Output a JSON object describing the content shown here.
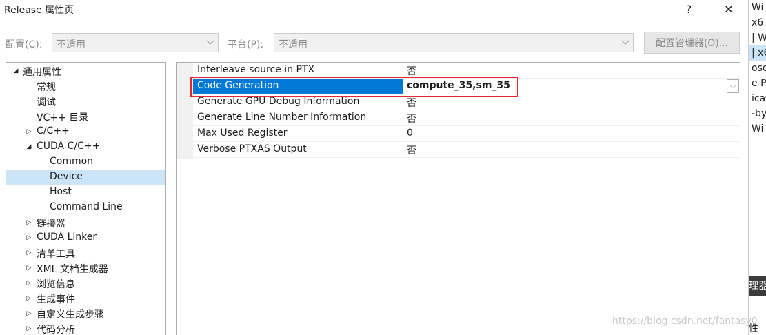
{
  "window": {
    "title": "Release 属性页",
    "help_glyph": "?",
    "close_glyph": "✕"
  },
  "config_bar": {
    "config_label": "配置(C):",
    "config_value": "不适用",
    "platform_label": "平台(P):",
    "platform_value": "不适用",
    "manager_button": "配置管理器(O)..."
  },
  "tree": {
    "items": [
      {
        "label": "通用属性",
        "toggle": "◢"
      },
      {
        "label": "常规",
        "toggle": ""
      },
      {
        "label": "调试",
        "toggle": ""
      },
      {
        "label": "VC++ 目录",
        "toggle": ""
      },
      {
        "label": "C/C++",
        "toggle": "▷"
      },
      {
        "label": "CUDA C/C++",
        "toggle": "◢"
      },
      {
        "label": "Common",
        "toggle": ""
      },
      {
        "label": "Device",
        "toggle": "",
        "selected": true
      },
      {
        "label": "Host",
        "toggle": ""
      },
      {
        "label": "Command Line",
        "toggle": ""
      },
      {
        "label": "链接器",
        "toggle": "▷"
      },
      {
        "label": "CUDA Linker",
        "toggle": "▷"
      },
      {
        "label": "清单工具",
        "toggle": "▷"
      },
      {
        "label": "XML 文档生成器",
        "toggle": "▷"
      },
      {
        "label": "浏览信息",
        "toggle": "▷"
      },
      {
        "label": "生成事件",
        "toggle": "▷"
      },
      {
        "label": "自定义生成步骤",
        "toggle": "▷"
      },
      {
        "label": "代码分析",
        "toggle": "▷"
      }
    ]
  },
  "properties": {
    "rows": [
      {
        "name": "Interleave source in PTX",
        "value": "否"
      },
      {
        "name": "Code Generation",
        "value": "compute_35,sm_35",
        "selected": true
      },
      {
        "name": "Generate GPU Debug Information",
        "value": "否"
      },
      {
        "name": "Generate Line Number Information",
        "value": "否"
      },
      {
        "name": "Max Used Register",
        "value": "0"
      },
      {
        "name": "Verbose PTXAS Output",
        "value": "否"
      }
    ],
    "dropdown_glyph": "⌵"
  },
  "background_window": {
    "lines": [
      "Wi",
      "x6",
      "| W",
      "| x6",
      "oso",
      "e P",
      "icat",
      "-by",
      "Wi"
    ],
    "dark_text": "理器",
    "bottom_text": "性"
  },
  "watermark": "https://blog.csdn.net/fantasy0"
}
